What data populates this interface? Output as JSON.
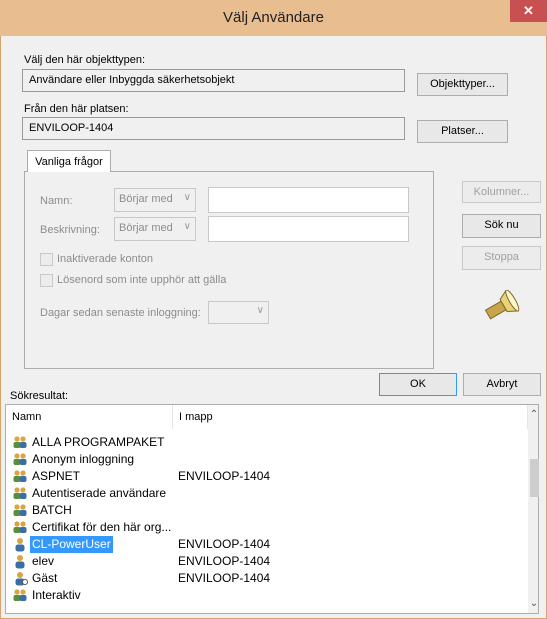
{
  "window": {
    "title": "Välj Användare",
    "close_glyph": "✕"
  },
  "object_type": {
    "label": "Välj den här objekttypen:",
    "value": "Användare eller Inbyggda säkerhetsobjekt",
    "button": "Objekttyper..."
  },
  "location": {
    "label": "Från den här platsen:",
    "value": "ENVILOOP-1404",
    "button": "Platser..."
  },
  "query": {
    "tab": "Vanliga frågor",
    "name_label": "Namn:",
    "name_mode": "Börjar med",
    "desc_label": "Beskrivning:",
    "desc_mode": "Börjar med",
    "disabled_accounts": "Inaktiverade konton",
    "nonexpiring_pw": "Lösenord som inte upphör att gälla",
    "days_label": "Dagar sedan senaste inloggning:",
    "days_value": ""
  },
  "side_buttons": {
    "columns": "Kolumner...",
    "search": "Sök nu",
    "stop": "Stoppa"
  },
  "dialog_buttons": {
    "ok": "OK",
    "cancel": "Avbryt"
  },
  "results": {
    "label": "Sökresultat:",
    "columns": [
      "Namn",
      "I mapp"
    ],
    "rows": [
      {
        "name": "ALLA PROGRAMPAKET",
        "folder": "",
        "selected": false,
        "icon": "group-icon"
      },
      {
        "name": "Anonym inloggning",
        "folder": "",
        "selected": false,
        "icon": "group-icon"
      },
      {
        "name": "ASPNET",
        "folder": "ENVILOOP-1404",
        "selected": false,
        "icon": "group-icon"
      },
      {
        "name": "Autentiserade användare",
        "folder": "",
        "selected": false,
        "icon": "group-icon"
      },
      {
        "name": "BATCH",
        "folder": "",
        "selected": false,
        "icon": "group-icon"
      },
      {
        "name": "Certifikat för den här org...",
        "folder": "",
        "selected": false,
        "icon": "group-icon"
      },
      {
        "name": "CL-PowerUser",
        "folder": "ENVILOOP-1404",
        "selected": true,
        "icon": "user-icon"
      },
      {
        "name": "elev",
        "folder": "ENVILOOP-1404",
        "selected": false,
        "icon": "user-icon"
      },
      {
        "name": "Gäst",
        "folder": "ENVILOOP-1404",
        "selected": false,
        "icon": "guest-user-icon"
      },
      {
        "name": "Interaktiv",
        "folder": "",
        "selected": false,
        "icon": "group-icon"
      }
    ]
  },
  "colors": {
    "titlebar": "#e8bd90",
    "selection": "#3399ff",
    "close": "#c75050"
  }
}
